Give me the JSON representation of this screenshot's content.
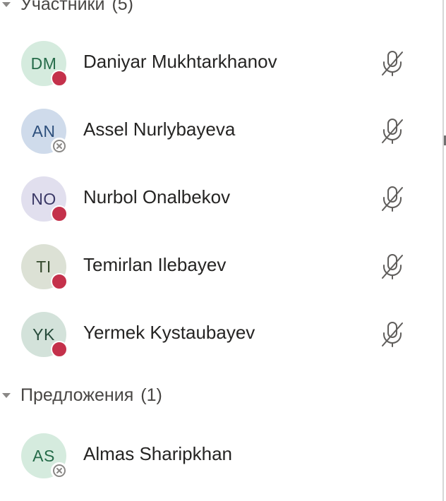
{
  "sections": [
    {
      "title": "Участники",
      "count": "(5)",
      "members": [
        {
          "initials": "DM",
          "name": "Daniyar Mukhtarkhanov",
          "status": "busy",
          "muted": true,
          "avatar_bg": "#d5ebde",
          "avatar_fg": "#256b49"
        },
        {
          "initials": "AN",
          "name": "Assel Nurlybayeva",
          "status": "offline",
          "muted": true,
          "avatar_bg": "#cfdbeb",
          "avatar_fg": "#2d4f7c"
        },
        {
          "initials": "NO",
          "name": "Nurbol Onalbekov",
          "status": "busy",
          "muted": true,
          "avatar_bg": "#e1dfee",
          "avatar_fg": "#3a3866"
        },
        {
          "initials": "TI",
          "name": "Temirlan Ilebayev",
          "status": "busy",
          "muted": true,
          "avatar_bg": "#dce1d5",
          "avatar_fg": "#33482b"
        },
        {
          "initials": "YK",
          "name": "Yermek Kystaubayev",
          "status": "busy",
          "muted": true,
          "avatar_bg": "#d3e2da",
          "avatar_fg": "#264a3a"
        }
      ]
    },
    {
      "title": "Предложения",
      "count": "(1)",
      "members": [
        {
          "initials": "AS",
          "name": "Almas Sharipkhan",
          "status": "offline",
          "muted": false,
          "avatar_bg": "#d5ebde",
          "avatar_fg": "#256b49"
        }
      ]
    }
  ],
  "colors": {
    "busy": "#c4314b",
    "offline_ring": "#8a8886",
    "mic_muted": "#605e5c"
  },
  "icons": {
    "muted": "mic-off-icon",
    "busy": "status-busy-dot",
    "offline": "status-offline-icon",
    "collapse": "caret-down-icon"
  }
}
